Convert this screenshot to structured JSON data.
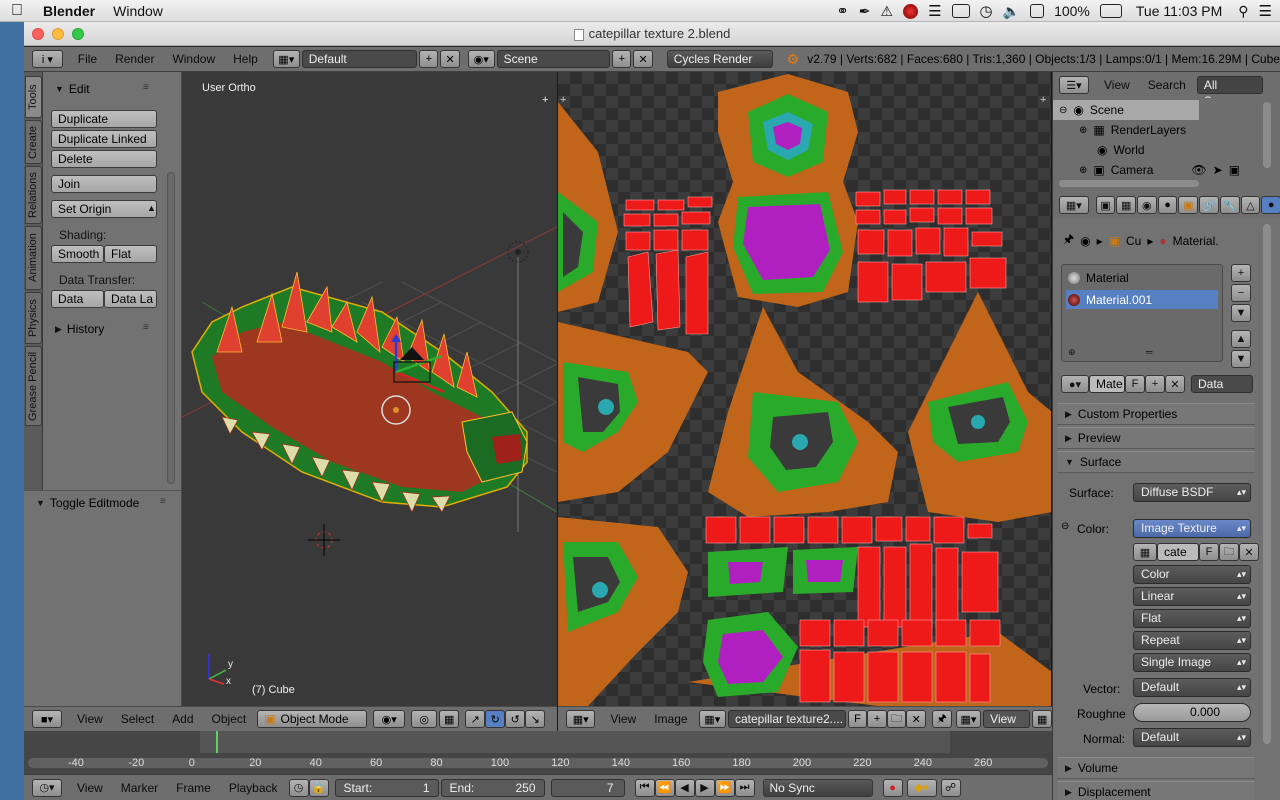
{
  "macos": {
    "app_name": "Blender",
    "menu": [
      "Window"
    ],
    "status": {
      "battery": "100%",
      "clock": "Tue 11:03 PM"
    }
  },
  "window": {
    "title": "catepillar texture 2.blend"
  },
  "header": {
    "menus": [
      "File",
      "Render",
      "Window",
      "Help"
    ],
    "layout": "Default",
    "scene": "Scene",
    "engine": "Cycles Render",
    "stats": "v2.79 | Verts:682 | Faces:680 | Tris:1,360 | Objects:1/3 | Lamps:0/1 | Mem:16.29M | Cube"
  },
  "toolshelf": {
    "tabs": [
      "Tools",
      "Create",
      "Relations",
      "Animation",
      "Physics",
      "Grease Pencil"
    ],
    "edit_header": "Edit",
    "buttons": {
      "duplicate": "Duplicate",
      "duplicate_linked": "Duplicate Linked",
      "delete": "Delete",
      "join": "Join",
      "set_origin": "Set Origin"
    },
    "shading_label": "Shading:",
    "smooth": "Smooth",
    "flat": "Flat",
    "data_transfer_label": "Data Transfer:",
    "data": "Data",
    "data_la": "Data La",
    "history": "History",
    "last_op": "Toggle Editmode"
  },
  "viewport": {
    "view_name": "User Ortho",
    "object_label": "(7) Cube",
    "menus": [
      "View",
      "Select",
      "Add",
      "Object"
    ],
    "mode": "Object Mode",
    "axis_y": "y",
    "axis_x": "x"
  },
  "uv_editor": {
    "menus": [
      "View",
      "Image"
    ],
    "image_name": "catepillar texture2....",
    "f_label": "F",
    "view_menu": "View"
  },
  "timeline": {
    "ticks": [
      "-40",
      "-20",
      "0",
      "20",
      "40",
      "60",
      "80",
      "100",
      "120",
      "140",
      "160",
      "180",
      "200",
      "220",
      "240",
      "260"
    ],
    "menus": [
      "View",
      "Marker",
      "Frame",
      "Playback"
    ],
    "start_label": "Start:",
    "start": "1",
    "end_label": "End:",
    "end": "250",
    "current": "7",
    "sync": "No Sync"
  },
  "outliner": {
    "menus": [
      "View",
      "Search"
    ],
    "filter": "All Scenes",
    "items": [
      "Scene",
      "RenderLayers",
      "World",
      "Camera"
    ]
  },
  "properties": {
    "breadcrumb_obj": "Cu",
    "breadcrumb_mat": "Material.",
    "materials": [
      "Material",
      "Material.001"
    ],
    "slot_name": "Mate",
    "slot_f": "F",
    "slot_link": "Data",
    "sections": {
      "custom": "Custom Properties",
      "preview": "Preview",
      "surface": "Surface",
      "volume": "Volume",
      "displacement": "Displacement"
    },
    "surface_label": "Surface:",
    "surface_value": "Diffuse BSDF",
    "color_label": "Color:",
    "color_value": "Image Texture",
    "image_name": "cate",
    "image_f": "F",
    "tex_color": "Color",
    "interpolation": "Linear",
    "projection": "Flat",
    "extension": "Repeat",
    "source": "Single Image",
    "vector_label": "Vector:",
    "vector_value": "Default",
    "roughness_label": "Roughne",
    "roughness_value": "0.000",
    "normal_label": "Normal:",
    "normal_value": "Default"
  }
}
